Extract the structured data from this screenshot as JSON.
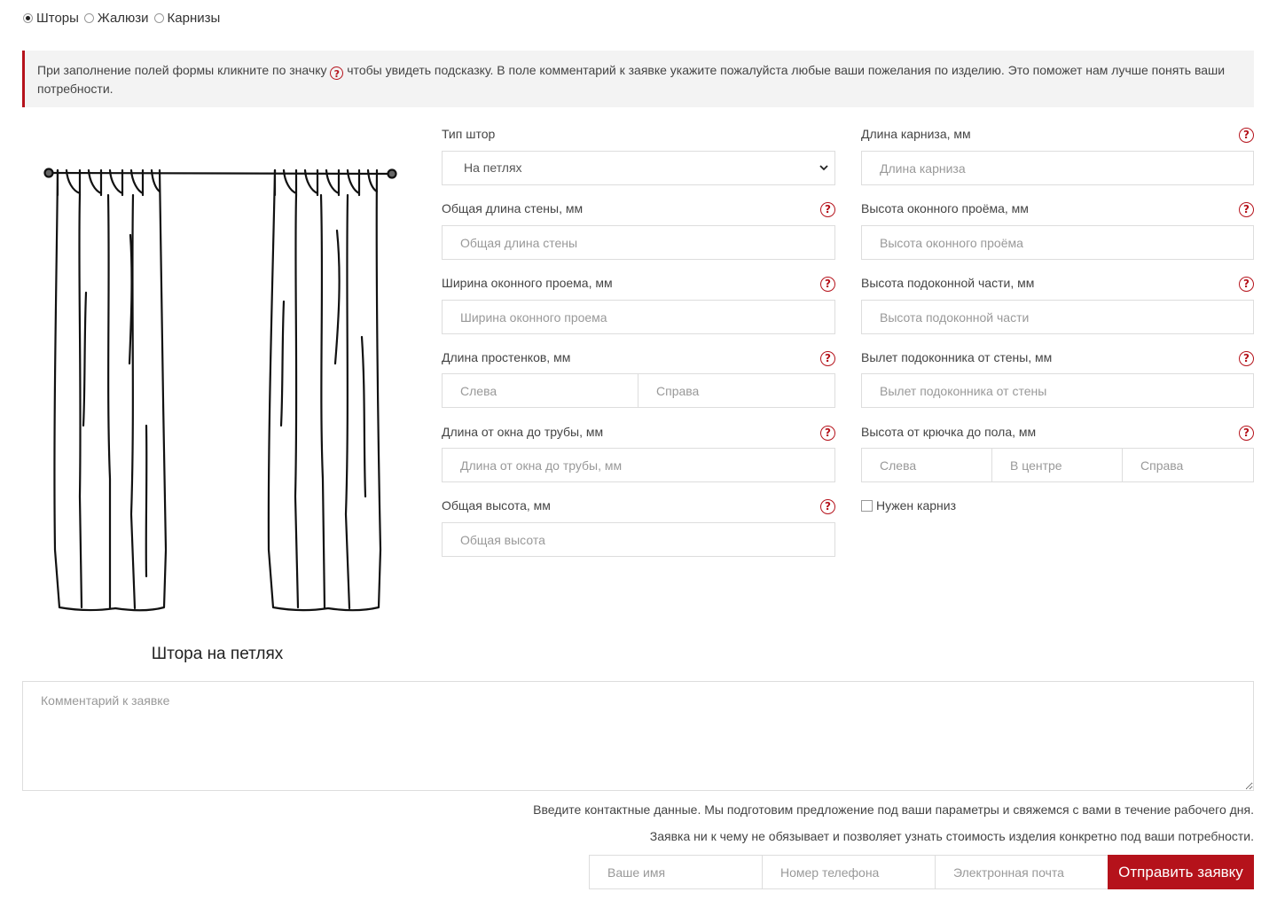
{
  "category_tabs": [
    {
      "label": "Шторы",
      "selected": true
    },
    {
      "label": "Жалюзи",
      "selected": false
    },
    {
      "label": "Карнизы",
      "selected": false
    }
  ],
  "notice": {
    "text_before": "При заполнение полей формы кликните по значку",
    "help_glyph": "?",
    "text_after": "чтобы увидеть подсказку. В поле комментарий к заявке укажите пожалуйста любые ваши пожелания по изделию. Это поможет нам лучше понять ваши потребности."
  },
  "illustration": {
    "caption": "Штора на петлях",
    "icon": "curtain-on-loops-illustration"
  },
  "help_glyph": "?",
  "form": {
    "curtain_type": {
      "label": "Тип штор",
      "value": "На петлях"
    },
    "wall_length": {
      "label": "Общая длина стены, мм",
      "placeholder": "Общая длина стены"
    },
    "window_width": {
      "label": "Ширина оконного проема, мм",
      "placeholder": "Ширина оконного проема"
    },
    "pier_length": {
      "label": "Длина простенков, мм",
      "left_placeholder": "Слева",
      "right_placeholder": "Справа"
    },
    "window_to_rod": {
      "label": "Длина от окна до трубы, мм",
      "placeholder": "Длина от окна до трубы, мм"
    },
    "total_height": {
      "label": "Общая высота, мм",
      "placeholder": "Общая высота"
    },
    "rod_length": {
      "label": "Длина карниза, мм",
      "placeholder": "Длина карниза"
    },
    "window_height": {
      "label": "Высота оконного проёма, мм",
      "placeholder": "Высота оконного проёма"
    },
    "sill_height": {
      "label": "Высота подоконной части, мм",
      "placeholder": "Высота подоконной части"
    },
    "sill_depth": {
      "label": "Вылет подоконника от стены, мм",
      "placeholder": "Вылет подоконника от стены"
    },
    "hook_to_floor": {
      "label": "Высота от крючка до пола, мм",
      "left_placeholder": "Слева",
      "center_placeholder": "В центре",
      "right_placeholder": "Справа"
    },
    "need_rod": {
      "label": "Нужен карниз",
      "checked": false
    }
  },
  "comment": {
    "placeholder": "Комментарий к заявке"
  },
  "contact": {
    "note1": "Введите контактные данные. Мы подготовим предложение под ваши параметры и свяжемся с вами в течение рабочего дня.",
    "note2": "Заявка ни к чему не обязывает и позволяет узнать стоимость изделия конкретно под ваши потребности.",
    "name_placeholder": "Ваше имя",
    "phone_placeholder": "Номер телефона",
    "email_placeholder": "Электронная почта",
    "submit_label": "Отправить заявку"
  },
  "colors": {
    "accent": "#b5121b",
    "notice_bg": "#f3f3f3",
    "border": "#dddddd"
  }
}
